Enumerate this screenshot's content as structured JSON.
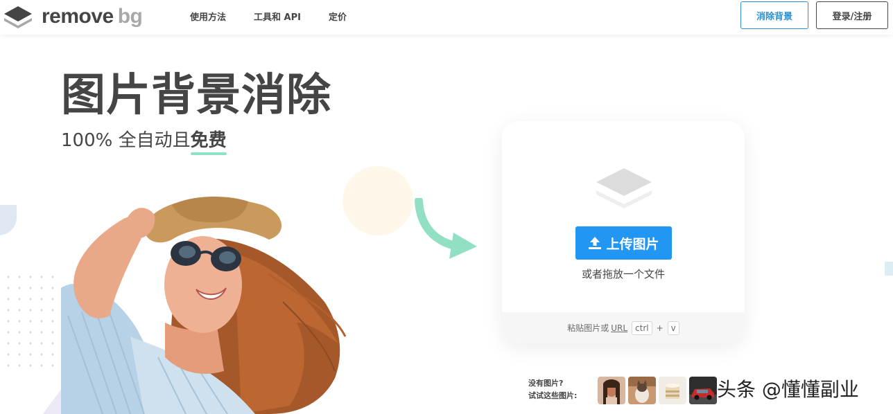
{
  "header": {
    "logo": {
      "word1": "remove",
      "word2": "bg"
    },
    "nav": [
      "使用方法",
      "工具和 API",
      "定价"
    ],
    "remove_bg_button": "消除背景",
    "login_button": "登录/注册"
  },
  "hero": {
    "title": "图片背景消除",
    "subtitle_prefix": "100% 全自动且",
    "subtitle_highlight": "免费"
  },
  "upload_card": {
    "upload_button": "上传图片",
    "drop_text": "或者拖放一个文件",
    "paste_prefix": "粘贴图片或",
    "paste_url": "URL",
    "key1": "ctrl",
    "plus": "+",
    "key2": "v"
  },
  "samples": {
    "line1": "没有图片?",
    "line2": "试试这些图片:",
    "thumbnails": [
      "woman",
      "cat",
      "cake",
      "car"
    ]
  },
  "watermark": "头条 @懂懂副业",
  "colors": {
    "accent_blue": "#2196f3",
    "outline_blue": "#2a8fd3",
    "text_dark": "#454545",
    "highlight_green": "#8fe3c4"
  }
}
